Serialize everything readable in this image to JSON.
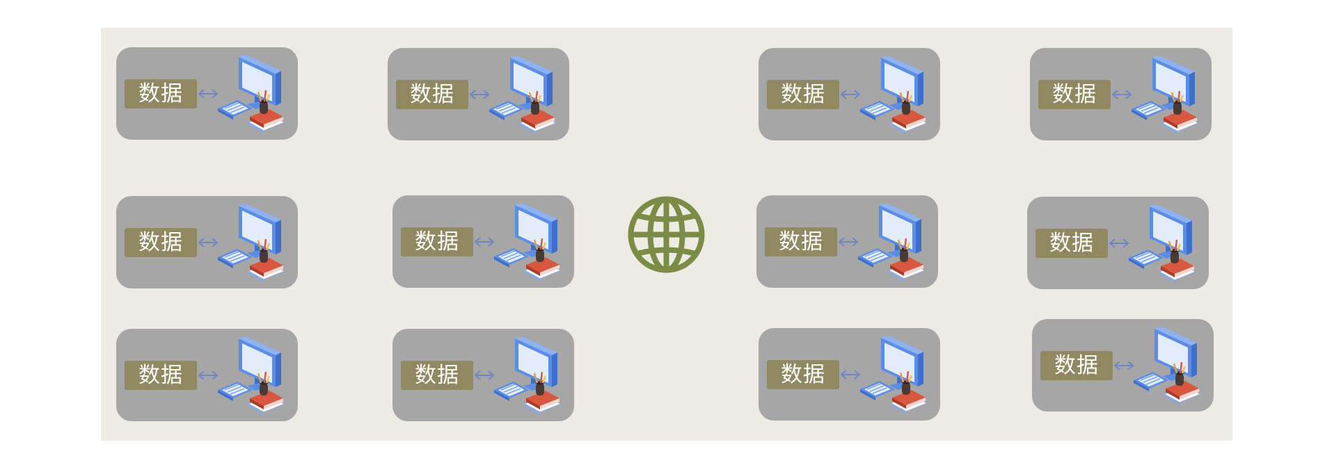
{
  "diagram": {
    "hub": {
      "icon": "globe-icon",
      "color": "#7b8c46"
    },
    "node_icon": "computer-desk-icon",
    "link_icon": "bidirectional-arrow-icon",
    "colors": {
      "panel": "#edebe3",
      "node": "#a6a6a6",
      "label": "#8f8860",
      "label_text": "#ffffff",
      "monitor": "#5b8de6",
      "books": "#d9573f"
    },
    "nodes": [
      {
        "label": "数据"
      },
      {
        "label": "数据"
      },
      {
        "label": "数据"
      },
      {
        "label": "数据"
      },
      {
        "label": "数据"
      },
      {
        "label": "数据"
      },
      {
        "label": "数据"
      },
      {
        "label": "数据"
      },
      {
        "label": "数据"
      },
      {
        "label": "数据"
      },
      {
        "label": "数据"
      },
      {
        "label": "数据"
      }
    ]
  }
}
